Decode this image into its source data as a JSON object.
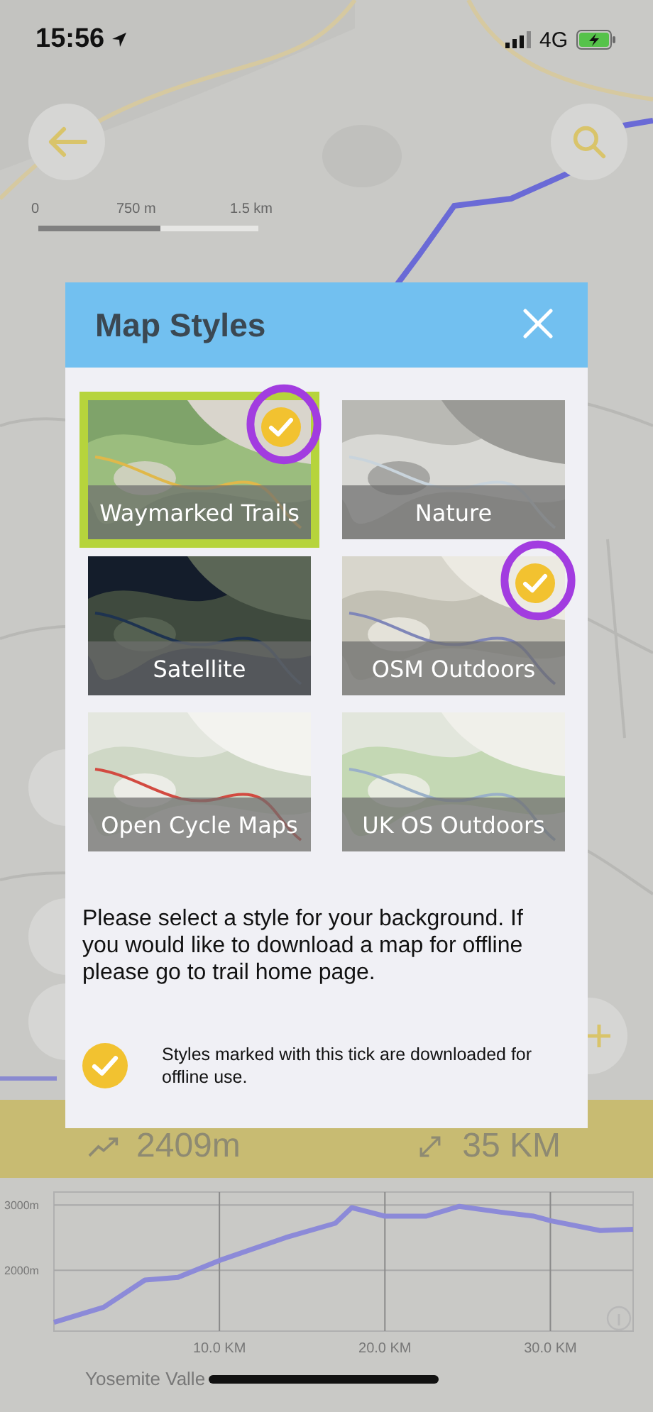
{
  "status_bar": {
    "time": "15:56",
    "network": "4G"
  },
  "map": {
    "scale_labels": [
      "0",
      "750 m",
      "1.5 km"
    ]
  },
  "modal": {
    "title": "Map Styles",
    "styles": [
      {
        "label": "Waymarked Trails",
        "selected": true,
        "downloaded": true,
        "circled": true
      },
      {
        "label": "Nature",
        "selected": false,
        "downloaded": false,
        "circled": false
      },
      {
        "label": "Satellite",
        "selected": false,
        "downloaded": false,
        "circled": false
      },
      {
        "label": "OSM Outdoors",
        "selected": false,
        "downloaded": true,
        "circled": true
      },
      {
        "label": "Open Cycle Maps",
        "selected": false,
        "downloaded": false,
        "circled": false
      },
      {
        "label": "UK OS Outdoors",
        "selected": false,
        "downloaded": false,
        "circled": false
      }
    ],
    "message": "Please select a style for your background. If you would like to download a map for offline please go to trail home page.",
    "legend": "Styles marked with this tick are downloaded for offline use."
  },
  "stats": [
    {
      "kind": "ascent",
      "value": "2409m"
    },
    {
      "kind": "distance",
      "value": "35 KM"
    }
  ],
  "elevation": {
    "chart_data": {
      "type": "line",
      "x": [
        0,
        3,
        5.5,
        7.5,
        10,
        14,
        17,
        18,
        20,
        22.5,
        24.5,
        27,
        29,
        30,
        33,
        35
      ],
      "grid": true,
      "series": [
        {
          "color": "#8c8ad8",
          "values": [
            1200,
            1430,
            1850,
            1890,
            2150,
            2500,
            2720,
            2960,
            2830,
            2830,
            2980,
            2890,
            2830,
            2760,
            2610,
            2630
          ]
        }
      ],
      "xlim": [
        0,
        35
      ],
      "ylim": [
        1065,
        3200
      ],
      "xticks": [
        {
          "value": 10,
          "label": "10.0 KM"
        },
        {
          "value": 20,
          "label": "20.0 KM"
        },
        {
          "value": 30,
          "label": "30.0 KM"
        }
      ],
      "yticks": [
        {
          "value": 2000,
          "label": "2000m"
        },
        {
          "value": 3000,
          "label": "3000m"
        }
      ]
    }
  },
  "route_name": "Yosemite Valle"
}
